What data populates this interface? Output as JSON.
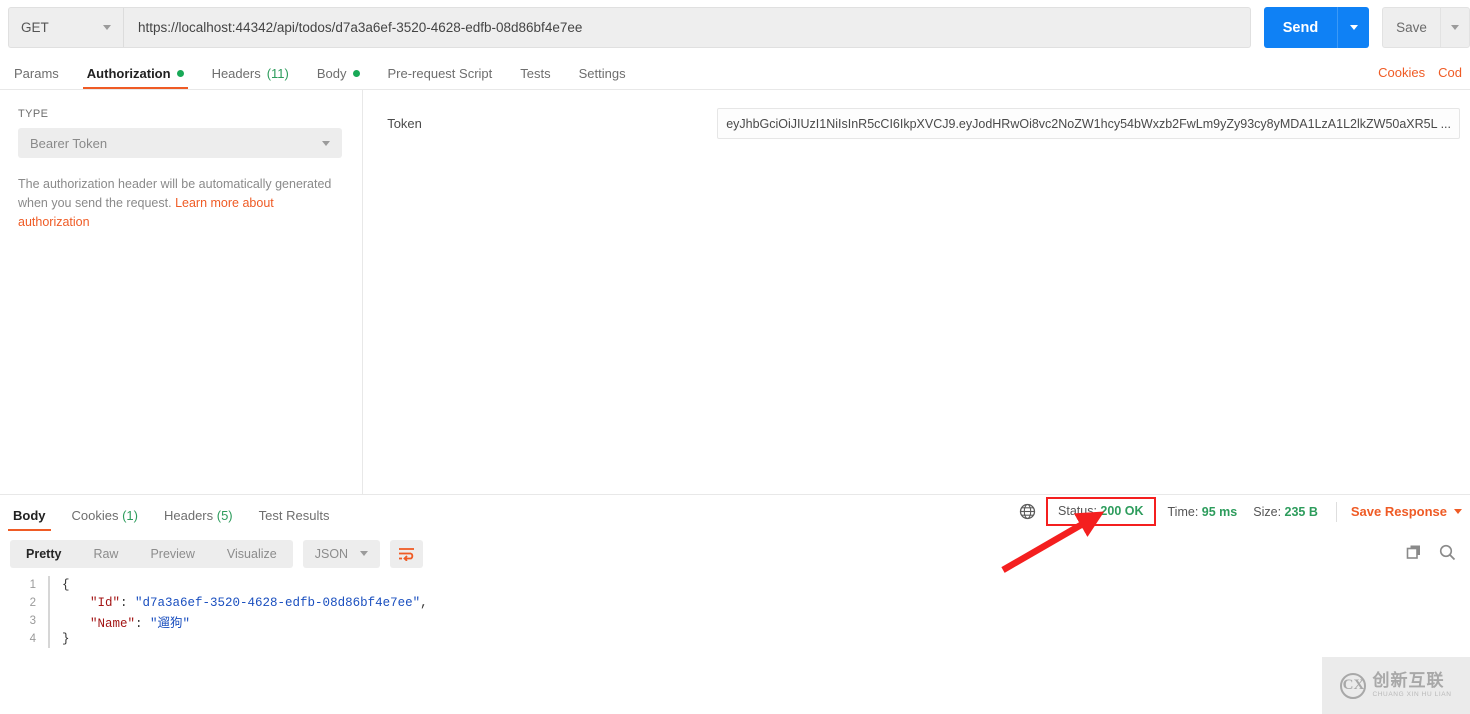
{
  "request": {
    "method": "GET",
    "url": "https://localhost:44342/api/todos/d7a3a6ef-3520-4628-edfb-08d86bf4e7ee",
    "send_label": "Send",
    "save_label": "Save"
  },
  "request_tabs": [
    {
      "label": "Params",
      "active": false,
      "dot": false,
      "count": ""
    },
    {
      "label": "Authorization",
      "active": true,
      "dot": true,
      "count": ""
    },
    {
      "label": "Headers",
      "active": false,
      "dot": false,
      "count": "(11)"
    },
    {
      "label": "Body",
      "active": false,
      "dot": true,
      "count": ""
    },
    {
      "label": "Pre-request Script",
      "active": false,
      "dot": false,
      "count": ""
    },
    {
      "label": "Tests",
      "active": false,
      "dot": false,
      "count": ""
    },
    {
      "label": "Settings",
      "active": false,
      "dot": false,
      "count": ""
    }
  ],
  "tab_links": [
    {
      "label": "Cookies"
    },
    {
      "label": "Cod"
    }
  ],
  "authorization": {
    "type_caption": "TYPE",
    "type_value": "Bearer Token",
    "help_text": "The authorization header will be automatically generated when you send the request. ",
    "help_link": "Learn more about authorization",
    "token_label": "Token",
    "token_value": "eyJhbGciOiJIUzI1NiIsInR5cCI6IkpXVCJ9.eyJodHRwOi8vc2NoZW1hcy54bWxzb2FwLm9yZy93cy8yMDA1LzA1L2lkZW50aXR5L ..."
  },
  "response_tabs": [
    {
      "label": "Body",
      "active": true,
      "count": ""
    },
    {
      "label": "Cookies",
      "active": false,
      "count": "(1)"
    },
    {
      "label": "Headers",
      "active": false,
      "count": "(5)"
    },
    {
      "label": "Test Results",
      "active": false,
      "count": ""
    }
  ],
  "response_meta": {
    "status_label": "Status:",
    "status_value": "200 OK",
    "time_label": "Time:",
    "time_value": "95 ms",
    "size_label": "Size:",
    "size_value": "235 B",
    "save_response_label": "Save Response"
  },
  "viewer_toolbar": {
    "modes": [
      {
        "label": "Pretty",
        "active": true
      },
      {
        "label": "Raw",
        "active": false
      },
      {
        "label": "Preview",
        "active": false
      },
      {
        "label": "Visualize",
        "active": false
      }
    ],
    "format": "JSON"
  },
  "response_body": {
    "lines": [
      {
        "no": "1",
        "indent": 0,
        "segments": [
          {
            "t": "{",
            "c": "k-punc"
          }
        ]
      },
      {
        "no": "2",
        "indent": 1,
        "segments": [
          {
            "t": "\"Id\"",
            "c": "k-key"
          },
          {
            "t": ": ",
            "c": "k-punc"
          },
          {
            "t": "\"d7a3a6ef-3520-4628-edfb-08d86bf4e7ee\"",
            "c": "k-str"
          },
          {
            "t": ",",
            "c": "k-punc"
          }
        ]
      },
      {
        "no": "3",
        "indent": 1,
        "segments": [
          {
            "t": "\"Name\"",
            "c": "k-key"
          },
          {
            "t": ": ",
            "c": "k-punc"
          },
          {
            "t": "\"遛狗\"",
            "c": "k-str"
          }
        ]
      },
      {
        "no": "4",
        "indent": 0,
        "segments": [
          {
            "t": "}",
            "c": "k-punc"
          }
        ]
      }
    ]
  },
  "watermark": {
    "mark": "CX",
    "cn": "创新互联",
    "en": "CHUANG XIN HU LIAN"
  },
  "colors": {
    "accent_orange": "#ef5b25",
    "send_blue": "#0f81f5",
    "status_green": "#2d9c5c",
    "annotation_red": "#f41f1f"
  }
}
